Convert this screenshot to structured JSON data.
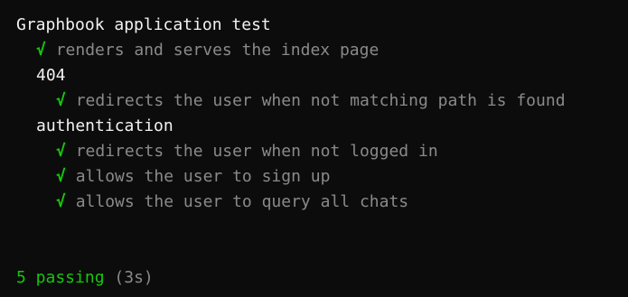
{
  "colors": {
    "background": "#0c0c0c",
    "suite_text": "#f2f2f2",
    "test_text": "#8a8a8a",
    "pass": "#16c60c"
  },
  "output": {
    "root_suite": "Graphbook application test",
    "test_index": "renders and serves the index page",
    "suite_404": "404",
    "test_404": "redirects the user when not matching path is found",
    "suite_auth": "authentication",
    "test_auth_1": "redirects the user when not logged in",
    "test_auth_2": "allows the user to sign up",
    "test_auth_3": "allows the user to query all chats",
    "check_mark": "√",
    "summary_count": "5 passing",
    "summary_time": "(3s)"
  }
}
